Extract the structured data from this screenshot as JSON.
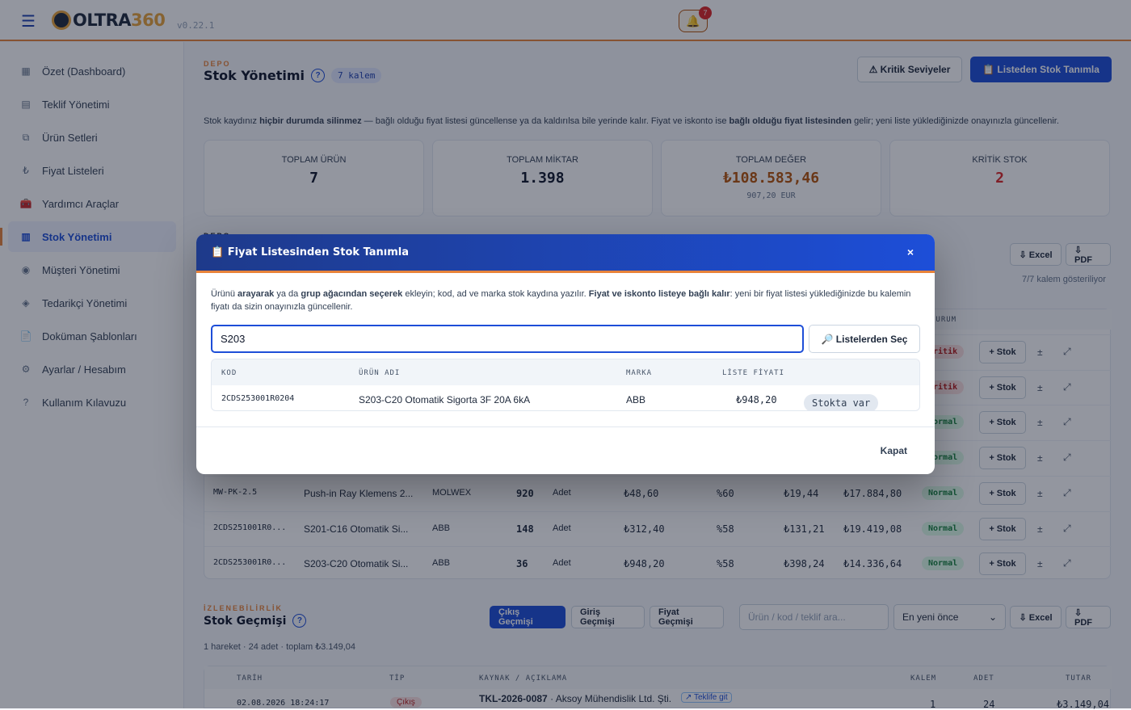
{
  "app": {
    "logo_main": "OLTRA",
    "logo_accent": "360",
    "version": "v0.22.1",
    "notifications": "7"
  },
  "sidebar": {
    "items": [
      {
        "label": "Özet (Dashboard)",
        "icon": "▦"
      },
      {
        "label": "Teklif Yönetimi",
        "icon": "▤"
      },
      {
        "label": "Ürün Setleri",
        "icon": "⧉"
      },
      {
        "label": "Fiyat Listeleri",
        "icon": "₺"
      },
      {
        "label": "Yardımcı Araçlar",
        "icon": "🧰"
      },
      {
        "label": "Stok Yönetimi",
        "icon": "▥",
        "active": true
      },
      {
        "label": "Müşteri Yönetimi",
        "icon": "◉"
      },
      {
        "label": "Tedarikçi Yönetimi",
        "icon": "◈"
      },
      {
        "label": "Doküman Şablonları",
        "icon": "📄"
      },
      {
        "label": "Ayarlar / Hesabım",
        "icon": "⚙"
      },
      {
        "label": "Kullanım Kılavuzu",
        "icon": "?"
      }
    ]
  },
  "page": {
    "eyebrow": "DEPO",
    "title": "Stok Yönetimi",
    "count_badge": "7 kalem",
    "btn_kritik": "⚠ Kritik Seviyeler",
    "btn_listeden": "📋 Listeden Stok Tanımla",
    "info_pre": "Stok kaydınız ",
    "info_b1": "hiçbir durumda silinmez",
    "info_mid": " — bağlı olduğu fiyat listesi güncellense ya da kaldırılsa bile yerinde kalır. Fiyat ve iskonto ise ",
    "info_b2": "bağlı olduğu fiyat listesinden",
    "info_post": " gelir; yeni liste yüklediğinizde onayınızla güncellenir."
  },
  "stats": [
    {
      "label": "TOPLAM ÜRÜN",
      "value": "7",
      "color": "#0f172a",
      "sub": ""
    },
    {
      "label": "TOPLAM MİKTAR",
      "value": "1.398",
      "color": "#0f172a",
      "sub": ""
    },
    {
      "label": "TOPLAM DEĞER",
      "value": "₺108.583,46",
      "color": "#b45309",
      "sub": "907,20 EUR"
    },
    {
      "label": "KRİTİK STOK",
      "value": "2",
      "color": "#dc2626",
      "sub": ""
    }
  ],
  "stock_section": {
    "eyebrow": "DEPO",
    "btn_excel": "⇩ Excel",
    "btn_pdf": "⇩ PDF",
    "showing": "7/7 kalem gösteriliyor",
    "col_status": "DURUM"
  },
  "stock_rows": [
    {
      "status": "Kritik",
      "status_type": "kritik"
    },
    {
      "status": "Kritik",
      "status_type": "kritik"
    },
    {
      "status": "Normal",
      "status_type": "normal"
    },
    {
      "status": "Normal",
      "status_type": "normal"
    },
    {
      "code": "MW-PK-2.5",
      "name": "Push-in Ray Klemens 2...",
      "brand": "MOLWEX",
      "qty": "920",
      "unit": "Adet",
      "price": "₺48,60",
      "disc": "%60",
      "net": "₺19,44",
      "total": "₺17.884,80",
      "status": "Normal",
      "status_type": "normal"
    },
    {
      "code": "2CDS251001R0...",
      "name": "S201-C16 Otomatik Si...",
      "brand": "ABB",
      "qty": "148",
      "unit": "Adet",
      "price": "₺312,40",
      "disc": "%58",
      "net": "₺131,21",
      "total": "₺19.419,08",
      "status": "Normal",
      "status_type": "normal"
    },
    {
      "code": "2CDS253001R0...",
      "name": "S203-C20 Otomatik Si...",
      "brand": "ABB",
      "qty": "36",
      "unit": "Adet",
      "price": "₺948,20",
      "disc": "%58",
      "net": "₺398,24",
      "total": "₺14.336,64",
      "status": "Normal",
      "status_type": "normal"
    }
  ],
  "row_action": "+ Stok",
  "history": {
    "eyebrow": "İZLENEBİLİRLİK",
    "title": "Stok Geçmişi",
    "tabs": [
      "Çıkış Geçmişi",
      "Giriş Geçmişi",
      "Fiyat Geçmişi"
    ],
    "search_placeholder": "Ürün / kod / teklif ara...",
    "sort": "En yeni önce",
    "btn_excel": "⇩ Excel",
    "btn_pdf": "⇩ PDF",
    "summary": "1 hareket · 24 adet · toplam ₺3.149,04",
    "cols": [
      "TARİH",
      "TİP",
      "KAYNAK / AÇIKLAMA",
      "KALEM",
      "ADET",
      "TUTAR"
    ],
    "row": {
      "date": "02.08.2026 18:24:17",
      "type": "Çıkış",
      "source": "TKL-2026-0087",
      "customer": "· Aksoy Mühendislik Ltd. Şti.",
      "link": "↗ Teklife git",
      "kalem": "1",
      "adet": "24",
      "tutar": "₺3.149,04"
    }
  },
  "modal": {
    "title": "📋 Fiyat Listesinden Stok Tanımla",
    "close": "×",
    "d1": "Ürünü ",
    "d2": "arayarak",
    "d3": " ya da ",
    "d4": "grup ağacından seçerek",
    "d5": " ekleyin; kod, ad ve marka stok kaydına yazılır. ",
    "d6": "Fiyat ve iskonto listeye bağlı kalır",
    "d7": ": yeni bir fiyat listesi yüklediğinizde bu kalemin fiyatı da sizin onayınızla güncellenir.",
    "search_value": "S203",
    "btn_list": "🔎 Listelerden Seç",
    "cols": {
      "code": "KOD",
      "name": "ÜRÜN ADI",
      "brand": "MARKA",
      "price": "LİSTE FİYATI"
    },
    "result": {
      "code": "2CDS253001R0204",
      "name": "S203-C20 Otomatik Sigorta 3F 20A 6kA",
      "brand": "ABB",
      "price": "₺948,20",
      "stock": "Stokta var"
    },
    "footer_close": "Kapat"
  }
}
